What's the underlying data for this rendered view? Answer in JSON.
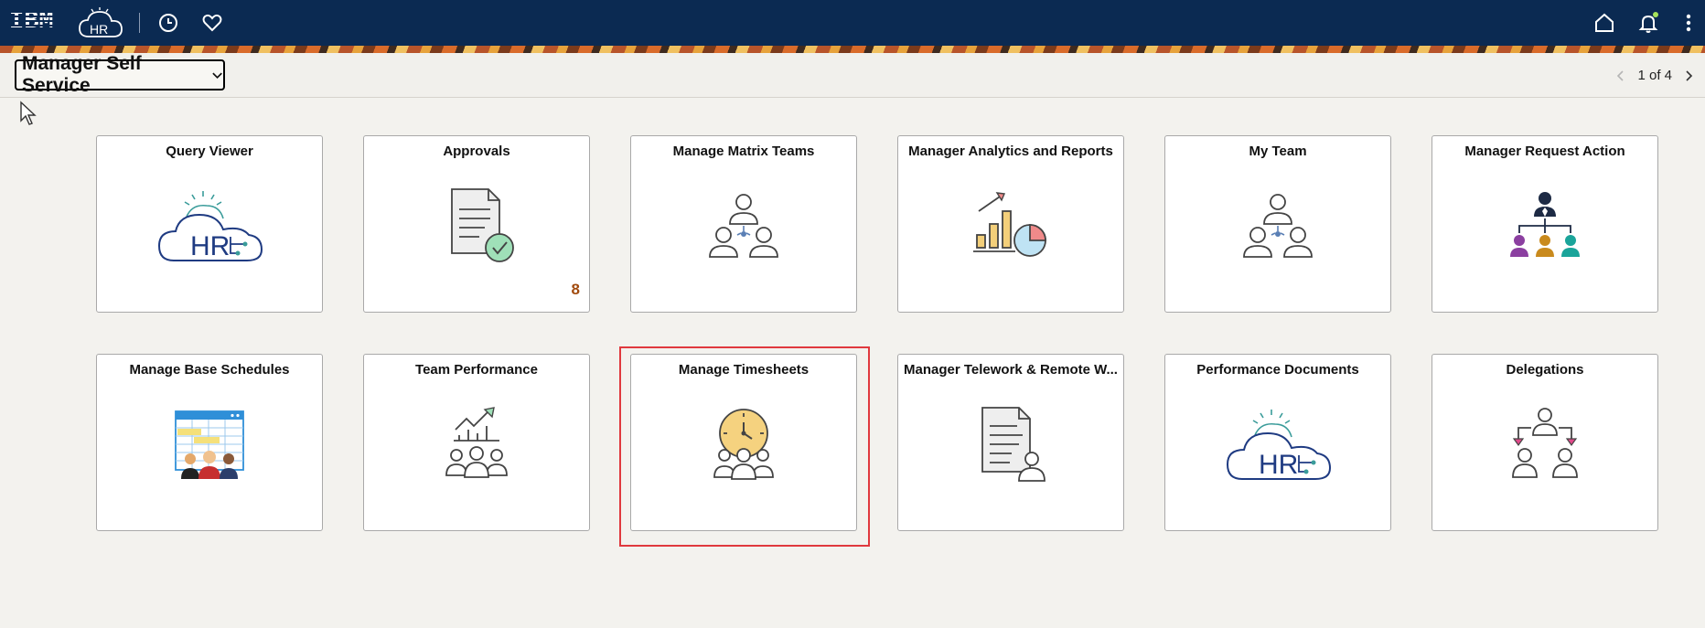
{
  "header": {
    "logo_text": "IBM",
    "hr_logo_text": "HR",
    "icons": [
      "history-icon",
      "favorites-icon",
      "home-icon",
      "notifications-icon",
      "actions-menu-icon"
    ]
  },
  "subheader": {
    "homepage_label": "Manager Self Service",
    "pager_text": "1 of 4"
  },
  "tiles": [
    {
      "title": "Query Viewer",
      "icon": "hr-cloud-icon"
    },
    {
      "title": "Approvals",
      "icon": "document-check-icon",
      "badge": "8"
    },
    {
      "title": "Manage Matrix Teams",
      "icon": "matrix-team-icon"
    },
    {
      "title": "Manager Analytics and Reports",
      "icon": "analytics-chart-icon"
    },
    {
      "title": "My Team",
      "icon": "team-icon"
    },
    {
      "title": "Manager Request Action",
      "icon": "org-chart-icon"
    },
    {
      "title": "Manage Base Schedules",
      "icon": "schedule-calendar-icon"
    },
    {
      "title": "Team Performance",
      "icon": "team-performance-icon"
    },
    {
      "title": "Manage Timesheets",
      "icon": "timesheet-clock-icon"
    },
    {
      "title": "Manager Telework & Remote W...",
      "icon": "telework-document-icon"
    },
    {
      "title": "Performance Documents",
      "icon": "hr-cloud-icon"
    },
    {
      "title": "Delegations",
      "icon": "delegation-icon"
    }
  ],
  "colors": {
    "header_bg": "#0b2a52",
    "highlight": "#e0393e",
    "badge": "#a14a0d"
  }
}
